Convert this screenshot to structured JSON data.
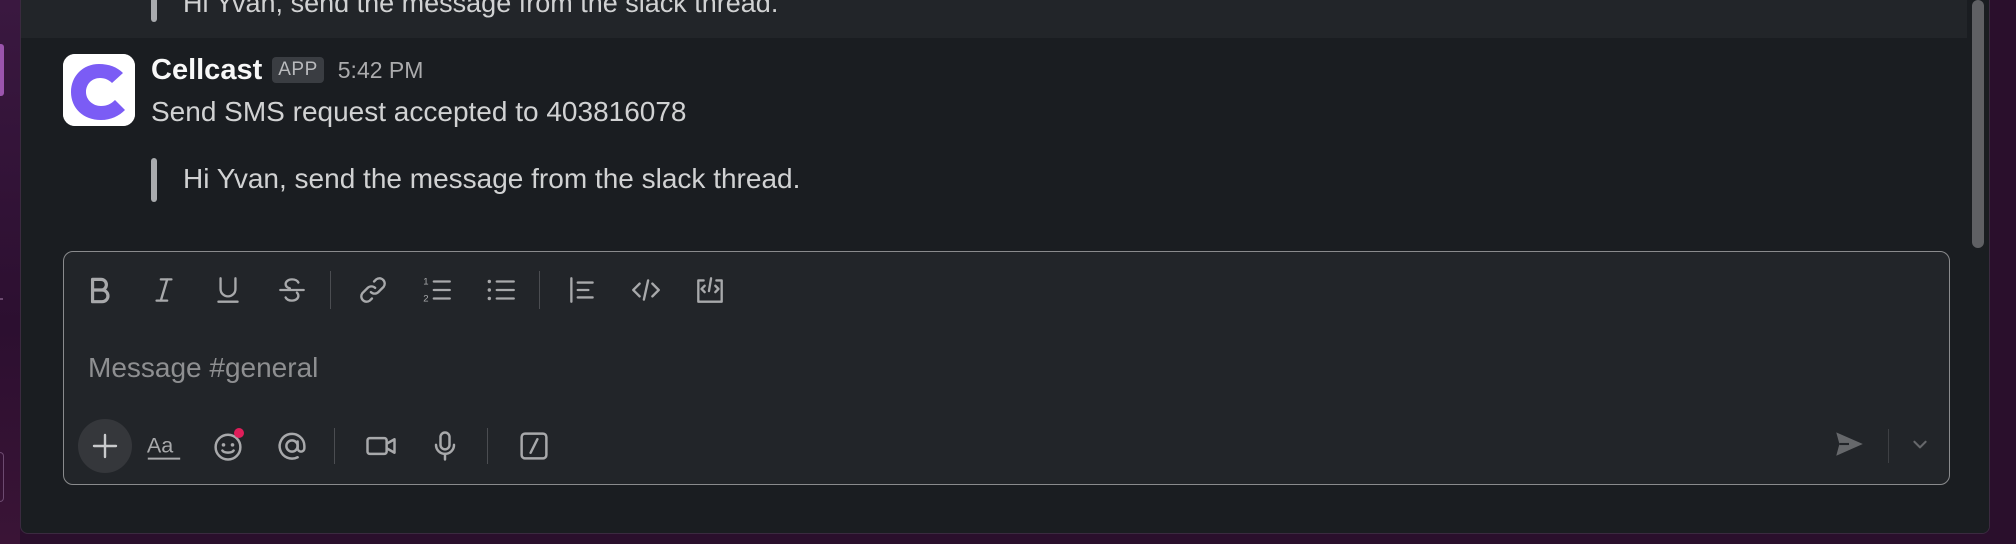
{
  "previous_message": {
    "quote_text": "Hi Yvan, send the message from the slack thread."
  },
  "message": {
    "sender": "Cellcast",
    "badge": "APP",
    "time": "5:42 PM",
    "text": "Send SMS request accepted to 403816078",
    "quote_text": "Hi Yvan, send the message from the slack thread.",
    "avatar_color": "#7b5cf5"
  },
  "composer": {
    "placeholder": "Message #general",
    "formatting_toolbar": [
      "bold-icon",
      "italic-icon",
      "underline-icon",
      "strikethrough-icon",
      "link-icon",
      "ordered-list-icon",
      "bulleted-list-icon",
      "blockquote-icon",
      "code-icon",
      "code-block-icon"
    ],
    "bottom_toolbar": [
      "plus-icon",
      "text-formatting-icon",
      "emoji-icon",
      "mention-icon",
      "video-icon",
      "microphone-icon",
      "slash-command-icon",
      "send-icon",
      "chevron-down-icon"
    ],
    "format_button_label": "Aa"
  },
  "colors": {
    "panel_bg": "#1a1d21",
    "workspace_purple": "#2a0f2c",
    "notification_dot": "#e01e5a"
  }
}
